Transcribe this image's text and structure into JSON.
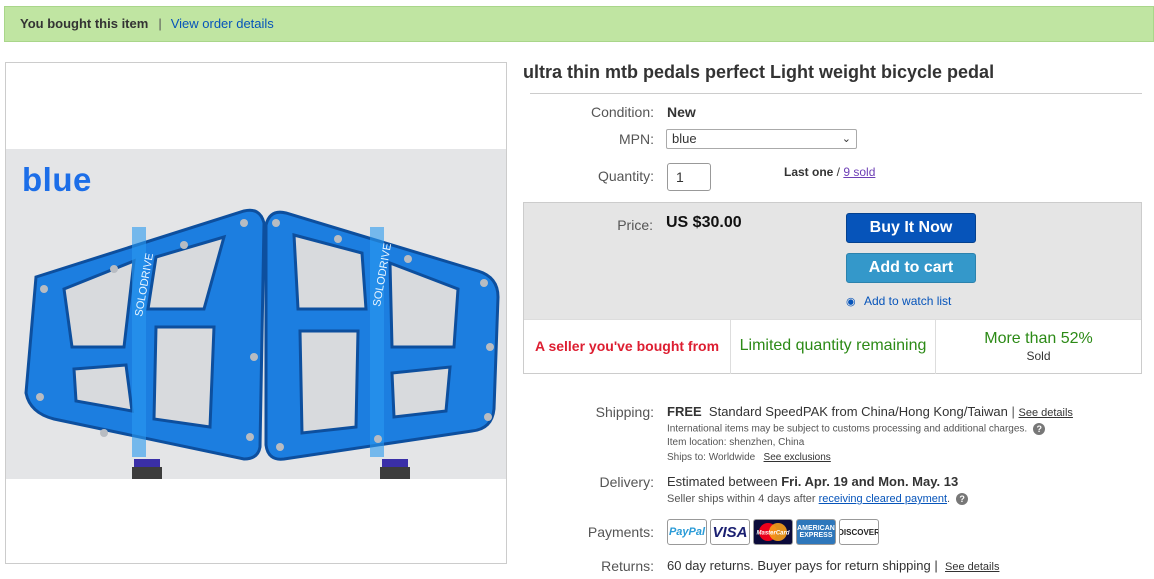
{
  "banner": {
    "bought_text": "You bought this item",
    "separator": "|",
    "order_link": "View order details"
  },
  "image": {
    "overlay_label": "blue",
    "brand_text": "SOLODRIVE"
  },
  "item": {
    "title": "ultra thin mtb pedals perfect Light weight bicycle pedal"
  },
  "condition": {
    "label": "Condition:",
    "value": "New"
  },
  "mpn": {
    "label": "MPN:",
    "selected": "blue"
  },
  "quantity": {
    "label": "Quantity:",
    "value": "1",
    "last_one": "Last one",
    "slash": " / ",
    "sold_link": "9 sold"
  },
  "price": {
    "label": "Price:",
    "value": "US $30.00",
    "buy_now": "Buy It Now",
    "add_to_cart": "Add to cart",
    "watch": "Add to watch list"
  },
  "highlights": {
    "seller": "A seller you've bought from",
    "limited": "Limited quantity remaining",
    "percent": "More than 52%",
    "sold": "Sold"
  },
  "shipping": {
    "label": "Shipping:",
    "free": "FREE",
    "method": "Standard SpeedPAK from China/Hong Kong/Taiwan",
    "pipe": "|",
    "details_link": "See details",
    "customs_note": "International items may be subject to customs processing and additional charges.",
    "location": "Item location:  shenzhen, China",
    "ships_to": "Ships to:  Worldwide",
    "exclusions_link": "See exclusions"
  },
  "delivery": {
    "label": "Delivery:",
    "prefix": "Estimated between ",
    "range": "Fri. Apr. 19 and Mon. May. 13",
    "sub_prefix": "Seller ships within 4 days after ",
    "sub_link": "receiving cleared payment",
    "sub_suffix": "."
  },
  "payments": {
    "label": "Payments:",
    "methods": [
      "PayPal",
      "VISA",
      "MasterCard",
      "AMERICAN EXPRESS",
      "DISCOVER"
    ]
  },
  "returns": {
    "label": "Returns:",
    "text": "60 day returns. Buyer pays for return shipping",
    "pipe": "|",
    "details_link": "See details"
  },
  "colors": {
    "banner_bg": "#c0e5a2",
    "link_blue": "#0654ba",
    "buy_button": "#0654ba",
    "cart_button": "#3498ca",
    "seller_red": "#dd1e31",
    "green": "#2c8a16",
    "pedal_blue": "#1c7ee0"
  }
}
